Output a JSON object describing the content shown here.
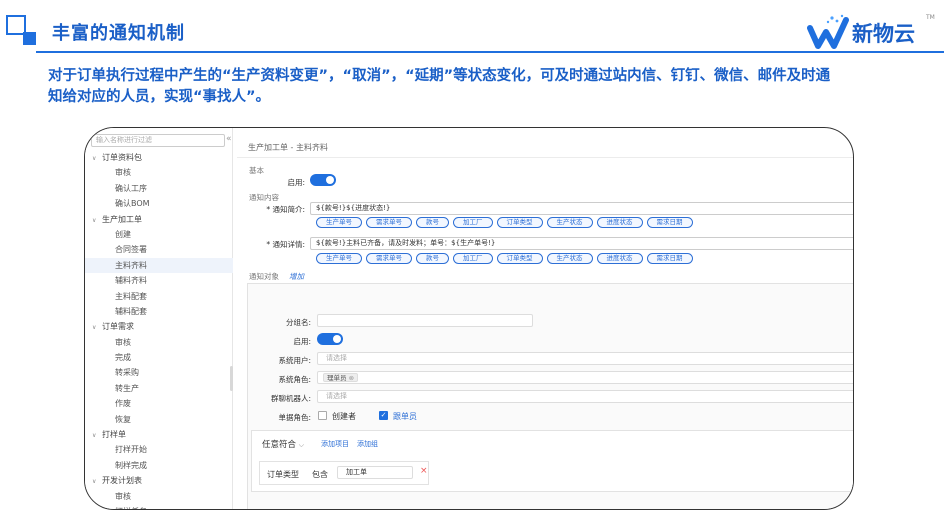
{
  "header": {
    "title": "丰富的通知机制"
  },
  "logo": {
    "name": "新物云",
    "tm": "TM"
  },
  "description": "对于订单执行过程中产生的“生产资料变更”，“取消”，“延期”等状态变化，可及时通过站内信、钉钉、微信、邮件及时通知给对应的人员，实现“事找人”。",
  "sidebar": {
    "search_placeholder": "输入名称进行过滤",
    "collapse_icon": "«",
    "items": [
      {
        "label": "订单资料包",
        "type": "grp"
      },
      {
        "label": "审核",
        "type": "leaf"
      },
      {
        "label": "确认工序",
        "type": "leaf"
      },
      {
        "label": "确认BOM",
        "type": "leaf"
      },
      {
        "label": "生产加工单",
        "type": "grp"
      },
      {
        "label": "创建",
        "type": "leaf"
      },
      {
        "label": "合同签署",
        "type": "leaf"
      },
      {
        "label": "主料齐料",
        "type": "leaf",
        "active": true
      },
      {
        "label": "辅料齐料",
        "type": "leaf"
      },
      {
        "label": "主料配套",
        "type": "leaf"
      },
      {
        "label": "辅料配套",
        "type": "leaf"
      },
      {
        "label": "订单需求",
        "type": "grp"
      },
      {
        "label": "审核",
        "type": "leaf"
      },
      {
        "label": "完成",
        "type": "leaf"
      },
      {
        "label": "转采购",
        "type": "leaf"
      },
      {
        "label": "转生产",
        "type": "leaf"
      },
      {
        "label": "作废",
        "type": "leaf"
      },
      {
        "label": "恢复",
        "type": "leaf"
      },
      {
        "label": "打样单",
        "type": "grp"
      },
      {
        "label": "打样开始",
        "type": "leaf"
      },
      {
        "label": "制样完成",
        "type": "leaf"
      },
      {
        "label": "开发计划表",
        "type": "grp"
      },
      {
        "label": "审核",
        "type": "leaf"
      },
      {
        "label": "打样任务",
        "type": "leaf"
      }
    ]
  },
  "main": {
    "breadcrumb": "生产加工单 - 主料齐料",
    "basic_section": "基本",
    "enable_label": "启用:",
    "notify_content_section": "通知内容",
    "brief_label": "* 通知简介:",
    "brief_template": "${款号!}${进度状态!}",
    "detail_label": "* 通知详情:",
    "detail_template": "${款号!}主料已齐备，请及时发料；单号：${生产单号!}",
    "chips": [
      "生产单号",
      "需求单号",
      "款号",
      "加工厂",
      "订单类型",
      "生产状态",
      "进度状态",
      "需求日期"
    ],
    "target_section": "通知对象",
    "add_link": "增加",
    "group_name_label": "分组名:",
    "group_enable_label": "启用:",
    "system_user_label": "系统用户:",
    "system_user_placeholder": "请选择",
    "system_role_label": "系统角色:",
    "system_role_tag": "理单员",
    "bot_label": "群聊机器人:",
    "bot_placeholder": "请选择",
    "doc_role_label": "单据角色:",
    "doc_role_creator": "创建者",
    "doc_role_follower": "跟单员",
    "condition_mode": "任意符合",
    "add_item_link": "添加项目",
    "add_group_link": "添加组",
    "condition_field": "订单类型",
    "condition_op": "包含",
    "condition_value": "加工单",
    "delete_icon": "×"
  },
  "colors": {
    "accent": "#1f6fde",
    "title": "#1a5fc7"
  }
}
